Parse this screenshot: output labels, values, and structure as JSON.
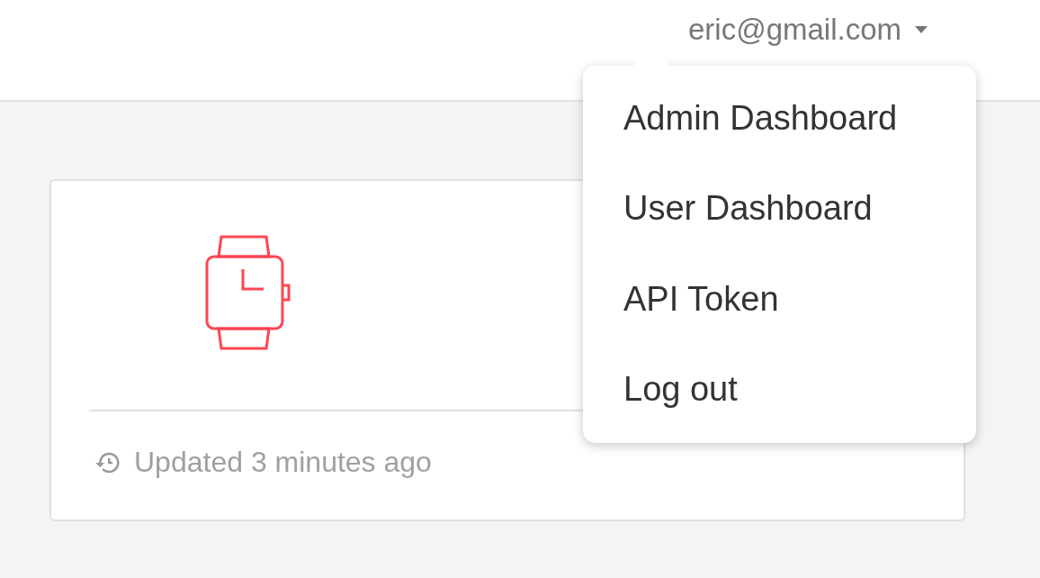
{
  "header": {
    "user_email": "eric@gmail.com"
  },
  "user_menu": [
    "Admin Dashboard",
    "User Dashboard",
    "API Token",
    "Log out"
  ],
  "card": {
    "footer": "Updated 3 minutes ago"
  }
}
